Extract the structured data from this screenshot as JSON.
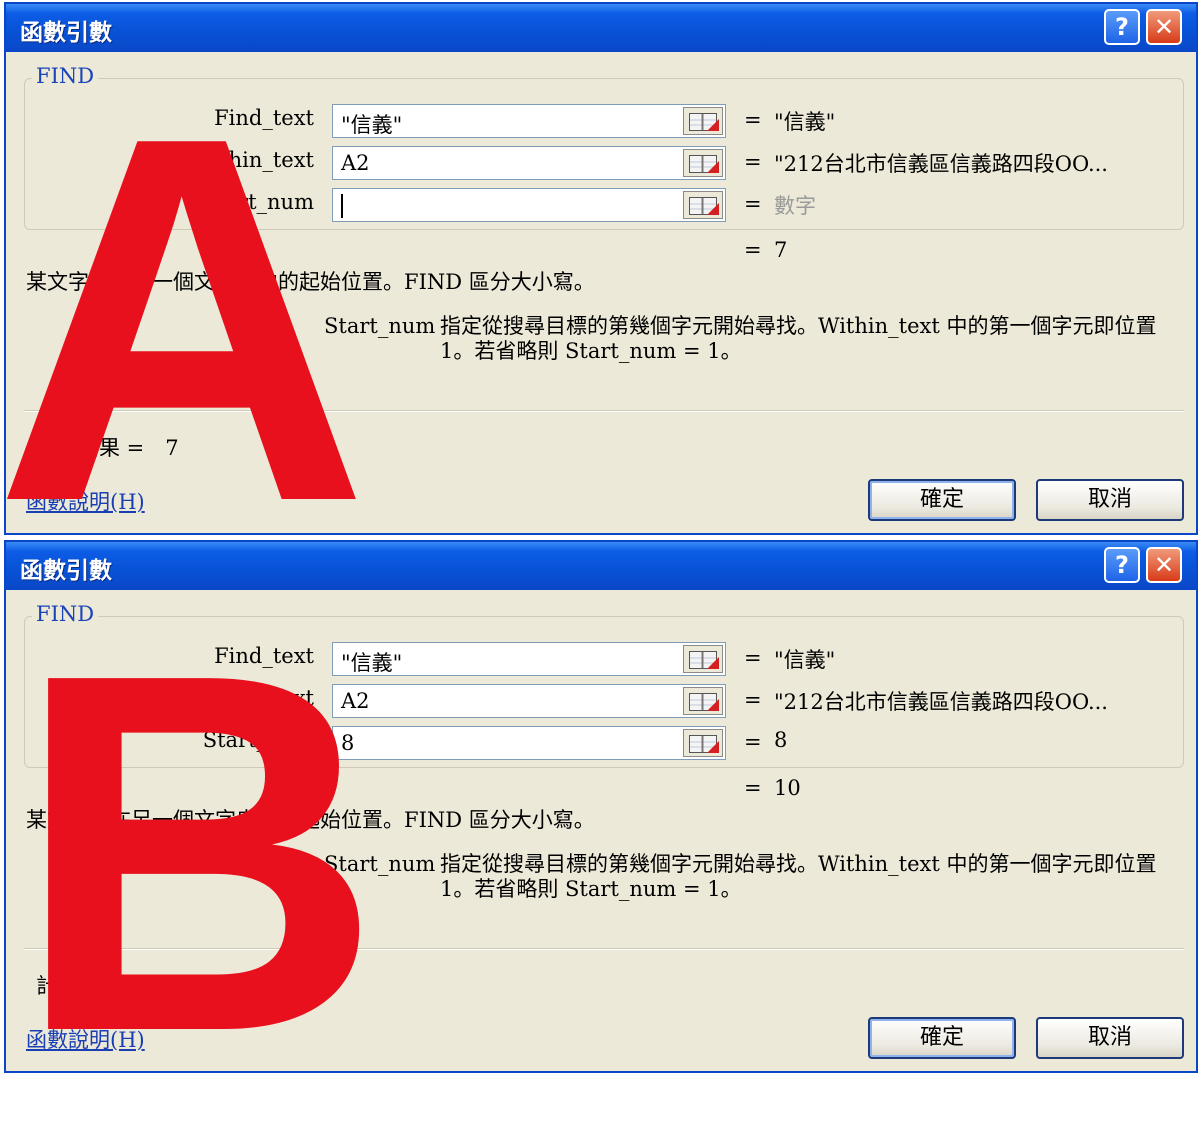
{
  "dialogs": [
    {
      "title": "函數引數",
      "help_btn": "?",
      "close_btn": "✕",
      "function_name": "FIND",
      "args": [
        {
          "label": "Find_text",
          "value": "\"信義\"",
          "result": "\"信義\""
        },
        {
          "label": "Within_text",
          "value": "A2",
          "result": "\"212台北市信義區信義路四段OO..."
        },
        {
          "label": "Start_num",
          "value": "",
          "result": "數字"
        }
      ],
      "formula_result_eq": "=",
      "formula_result_value": "7",
      "description": "某文字串在另一個文字串中的起始位置。FIND 區分大小寫。",
      "arg_desc_name": "Start_num",
      "arg_desc_text": "指定從搜尋目標的第幾個字元開始尋找。Within_text 中的第一個字元即位置 1。若省略則 Start_num = 1。",
      "result_line": "計算結果 =　7",
      "help_link": "函數說明(H)",
      "ok_label": "確定",
      "cancel_label": "取消",
      "overlay_letter": "A"
    },
    {
      "title": "函數引數",
      "help_btn": "?",
      "close_btn": "✕",
      "function_name": "FIND",
      "args": [
        {
          "label": "Find_text",
          "value": "\"信義\"",
          "result": "\"信義\""
        },
        {
          "label": "Within_text",
          "value": "A2",
          "result": "\"212台北市信義區信義路四段OO..."
        },
        {
          "label": "Start_num",
          "value": "8",
          "result": "8"
        }
      ],
      "formula_result_eq": "=",
      "formula_result_value": "10",
      "description": "某文字串在另一個文字串中的起始位置。FIND 區分大小寫。",
      "arg_desc_name": "Start_num",
      "arg_desc_text": "指定從搜尋目標的第幾個字元開始尋找。Within_text 中的第一個字元即位置 1。若省略則 Start_num = 1。",
      "result_line": "計",
      "help_link": "函數說明(H)",
      "ok_label": "確定",
      "cancel_label": "取消",
      "overlay_letter": "B"
    }
  ],
  "colors": {
    "overlay": "#e8101c",
    "titlebar": "#0853d7",
    "dialog_bg": "#ece9d8"
  }
}
